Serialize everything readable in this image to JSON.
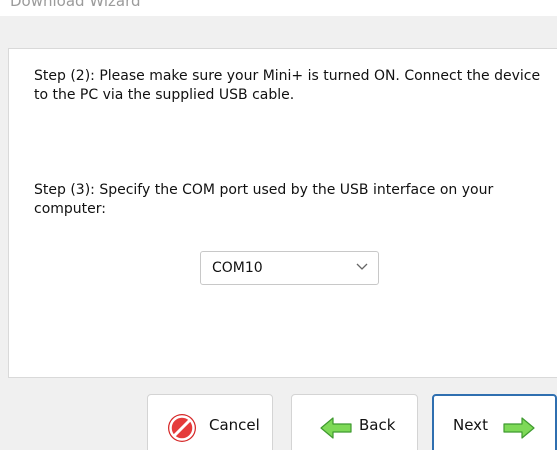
{
  "window": {
    "title": "Download Wizard"
  },
  "steps": {
    "step2": "Step (2): Please make sure your Mini+ is turned ON. Connect the device to the PC via the supplied USB cable.",
    "step3": "Step (3): Specify the COM port used by the USB interface on your computer:"
  },
  "com_port": {
    "selected": "COM10",
    "icon": "chevron-down-icon"
  },
  "buttons": {
    "cancel": {
      "label": "Cancel",
      "icon": "cancel-icon",
      "color": "#d62828"
    },
    "back": {
      "label": "Back",
      "icon": "back-arrow-icon",
      "color": "#6fd26a"
    },
    "next": {
      "label": "Next",
      "icon": "next-arrow-icon",
      "color": "#6fd26a"
    }
  },
  "colors": {
    "accent": "#2f6fb0"
  }
}
